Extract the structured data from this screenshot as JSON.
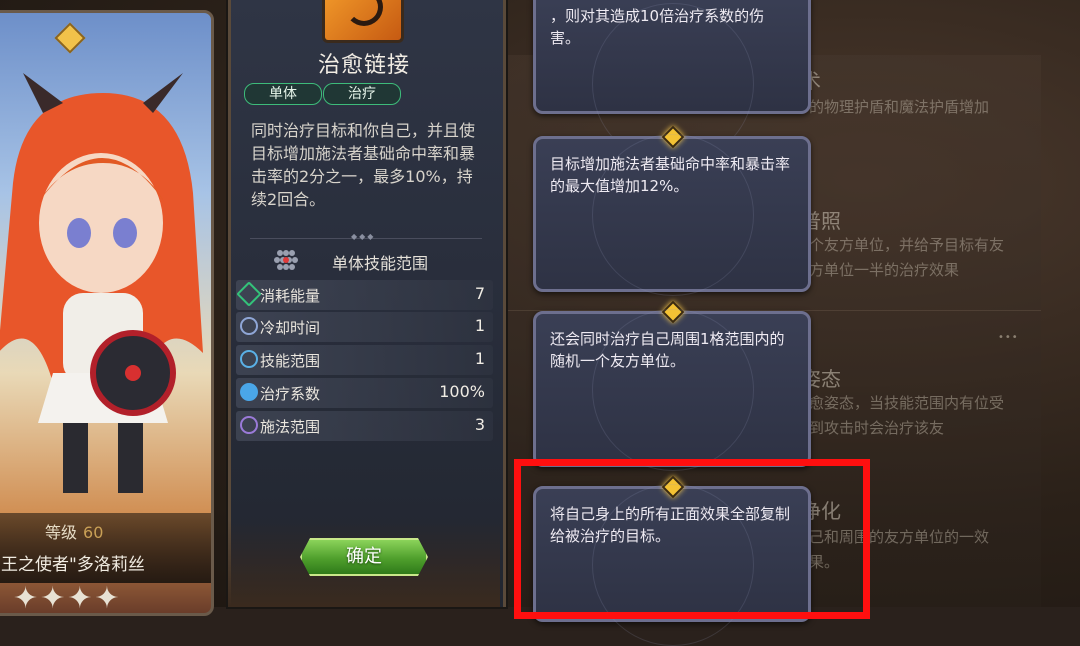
{
  "character": {
    "level_label": "等级",
    "level_value": "60",
    "name": "王之使者\"多洛莉丝",
    "stars": "✦✦✦✦"
  },
  "skill": {
    "title": "治愈链接",
    "tags": [
      "单体",
      "治疗"
    ],
    "description": "同时治疗目标和你自己，并且使目标增加施法者基础命中率和暴击率的2分之一，最多10%，持续2回合。",
    "range_label": "单体技能范围",
    "stats": [
      {
        "label": "消耗能量",
        "value": "7",
        "icon": "diamond-icon",
        "color": "#34c27a"
      },
      {
        "label": "冷却时间",
        "value": "1",
        "icon": "cooldown-icon",
        "color": "#8fa6d6"
      },
      {
        "label": "技能范围",
        "value": "1",
        "icon": "range-icon",
        "color": "#5ab0e6"
      },
      {
        "label": "治疗系数",
        "value": "100%",
        "icon": "heal-icon",
        "color": "#4aa6e8"
      },
      {
        "label": "施法范围",
        "value": "3",
        "icon": "cast-range-icon",
        "color": "#9a7ad8"
      }
    ],
    "confirm_label": "确定"
  },
  "upgrades": [
    {
      "text": "，则对其造成10倍治疗系数的伤害。"
    },
    {
      "text": "目标增加施法者基础命中率和暴击率的最大值增加12%。"
    },
    {
      "text": "还会同时治疗自己周围1格范围内的随机一个友方单位。"
    },
    {
      "text": "将自己身上的所有正面效果全部复制给被治疗的目标。"
    }
  ],
  "background": {
    "items": [
      {
        "title": "术",
        "text": "的物理护盾和魔法护盾增加"
      },
      {
        "title": "普照",
        "text": "个友方单位，并给予目标有友方单位一半的治疗效果"
      },
      {
        "title": "姿态",
        "text": "愈姿态，当技能范围内有位受到攻击时会治疗该友"
      },
      {
        "title": "净化",
        "text": "己和周围的友方单位的一效果。"
      }
    ]
  },
  "colors": {
    "highlight": "#ff0f0f",
    "tag_border": "#3dbb7a",
    "confirm": "#4f9f2c"
  }
}
